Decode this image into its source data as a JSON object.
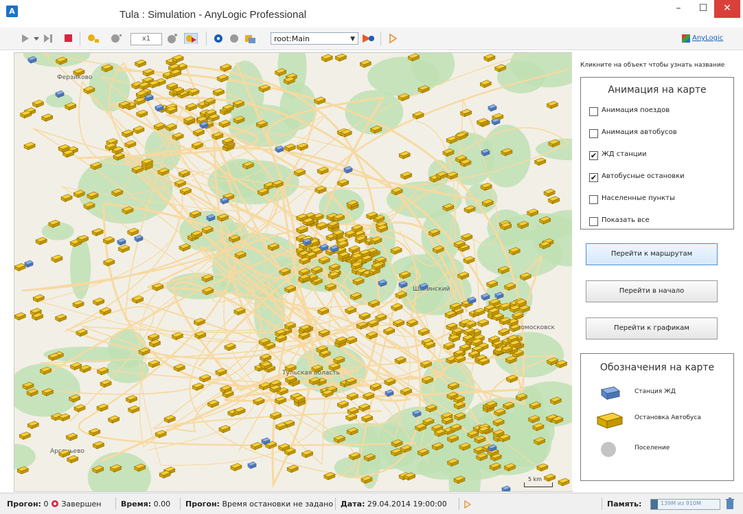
{
  "window": {
    "title": "Tula : Simulation - AnyLogic Professional",
    "minimize": "–",
    "maximize": "☐",
    "close": "✕"
  },
  "toolbar": {
    "speed": "x1",
    "experiment": "root:Main",
    "brand": "AnyLogic"
  },
  "map": {
    "place_labels": [
      "Ферзиково",
      "Шакинский",
      "Новомосковск",
      "Тульская область",
      "Арсеньево"
    ],
    "scale_label": "5 km",
    "colors": {
      "background": "#f2efe6",
      "forest": "#bfe0b4",
      "road": "#f7d9a0",
      "bus_stop": "#e8b90c",
      "rail_station": "#5d86c9"
    }
  },
  "panel": {
    "hint": "Кликните на объект чтобы узнать название",
    "animation_title": "Анимация на карте",
    "checkboxes": [
      {
        "label": "Анимация поездов",
        "checked": false
      },
      {
        "label": "Анимация автобусов",
        "checked": false
      },
      {
        "label": "ЖД станции",
        "checked": true
      },
      {
        "label": "Автобусные остановки",
        "checked": true
      },
      {
        "label": "Населенные пункты",
        "checked": false
      },
      {
        "label": "Показать все",
        "checked": false
      }
    ],
    "buttons": {
      "routes": "Перейти к маршрутам",
      "start": "Перейти в начало",
      "charts": "Перейти к графикам"
    },
    "legend_title": "Обозначения на карте",
    "legend": {
      "rail": "Станция ЖД",
      "bus": "Остановка Автобуса",
      "settlement": "Поселение"
    }
  },
  "status": {
    "run_label": "Прогон:",
    "run_value": "0",
    "run_state": "Завершен",
    "time_label": "Время:",
    "time_value": "0.00",
    "stop_label": "Прогон:",
    "stop_value": "Время остановки не задано",
    "date_label": "Дата:",
    "date_value": "29.04.2014 19:00:00",
    "memory_label": "Память:",
    "memory_value": "139M из 910M"
  }
}
